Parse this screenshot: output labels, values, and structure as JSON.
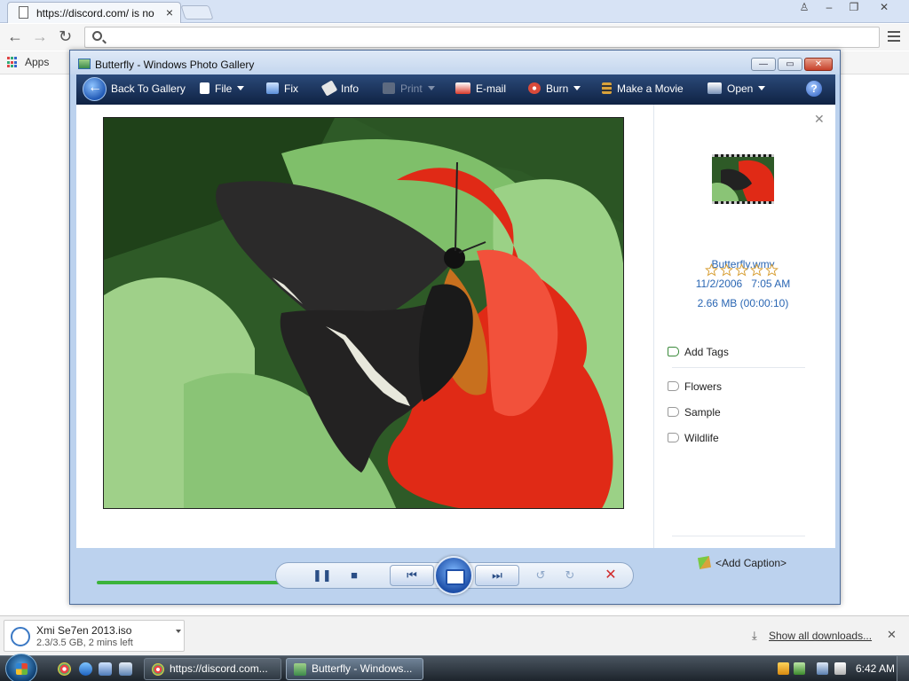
{
  "browser": {
    "tab_title": "https://discord.com/ is no",
    "omnibox_value": "",
    "bookmarks": {
      "apps_label": "Apps"
    }
  },
  "gallery": {
    "window_title": "Butterfly - Windows Photo Gallery",
    "toolbar": {
      "back": "Back To Gallery",
      "file": "File",
      "fix": "Fix",
      "info": "Info",
      "print": "Print",
      "email": "E-mail",
      "burn": "Burn",
      "make_movie": "Make a Movie",
      "open": "Open",
      "help": "?"
    },
    "info_pane": {
      "file_name": "Butterfly.wmv",
      "date": "11/2/2006",
      "time": "7:05 AM",
      "size": "2.66 MB (00:00:10)",
      "rating": 0,
      "rating_max": 5,
      "add_tags": "Add Tags",
      "tags": [
        "Flowers",
        "Sample",
        "Wildlife"
      ],
      "add_caption": "<Add Caption>"
    },
    "playback_progress": 0.865
  },
  "downloads": {
    "file_name": "Xmi Se7en 2013.iso",
    "status": "2.3/3.5 GB, 2 mins left",
    "show_all": "Show all downloads..."
  },
  "taskbar": {
    "items": [
      {
        "label": "https://discord.com...",
        "active": false
      },
      {
        "label": "Butterfly - Windows...",
        "active": true
      }
    ],
    "clock": "6:42 AM"
  },
  "colors": {
    "accent": "#2a66b3",
    "progress": "#3bb33b",
    "delete": "#d12b2b"
  }
}
